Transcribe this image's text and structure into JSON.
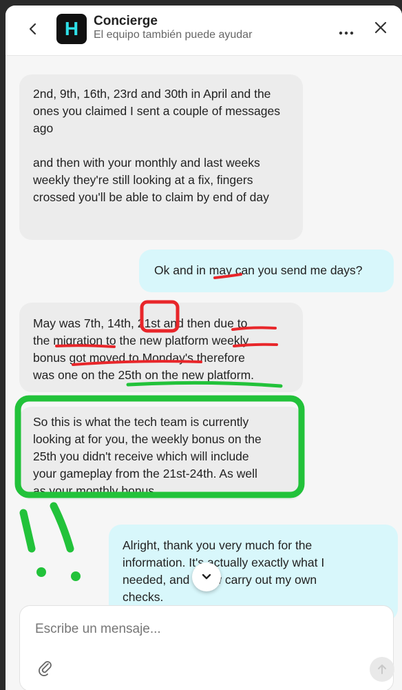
{
  "header": {
    "title": "Concierge",
    "subtitle": "El equipo también puede ayudar",
    "logo_letter": "H"
  },
  "messages": [
    {
      "sender": "agent",
      "paragraphs": [
        "2nd, 9th, 16th, 23rd and 30th in April and the ones you claimed I sent a couple of messages ago",
        "and then with your monthly and last weeks weekly they're still looking at a fix, fingers crossed you'll be able to claim by end of day"
      ]
    },
    {
      "sender": "user",
      "text": "Ok and in may can you send me days?"
    },
    {
      "sender": "agent",
      "lines": [
        "May was 7th, 14th, 21st and then due to",
        "the migration to the new platform weekly",
        "bonus got moved to Monday's therefore",
        "was one on the 25th on the new platform."
      ]
    },
    {
      "sender": "agent",
      "lines": [
        "So this is what the tech team is currently",
        "looking at for you, the weekly bonus on the",
        "25th you didn't receive which will include",
        "your gameplay from the 21st-24th. As well",
        "as your monthly bonus."
      ]
    },
    {
      "sender": "user",
      "lines": [
        "Alright, thank you very much for the",
        "information. It's actually exactly what I",
        "needed, and I now carry out my own",
        "checks."
      ]
    }
  ],
  "composer": {
    "placeholder": "Escribe un mensaje..."
  },
  "icons": {
    "back": "chevron-left-icon",
    "more": "more-horizontal-icon",
    "close": "close-icon",
    "attach": "paperclip-icon",
    "send": "arrow-up-icon",
    "scroll_down": "chevron-down-icon"
  },
  "colors": {
    "user_bubble": "#d8f7fb",
    "agent_bubble": "#ececec",
    "logo_bg": "#111111",
    "logo_letter": "#2fe0e8",
    "annotation_red": "#e8262a",
    "annotation_green": "#22c23a"
  }
}
